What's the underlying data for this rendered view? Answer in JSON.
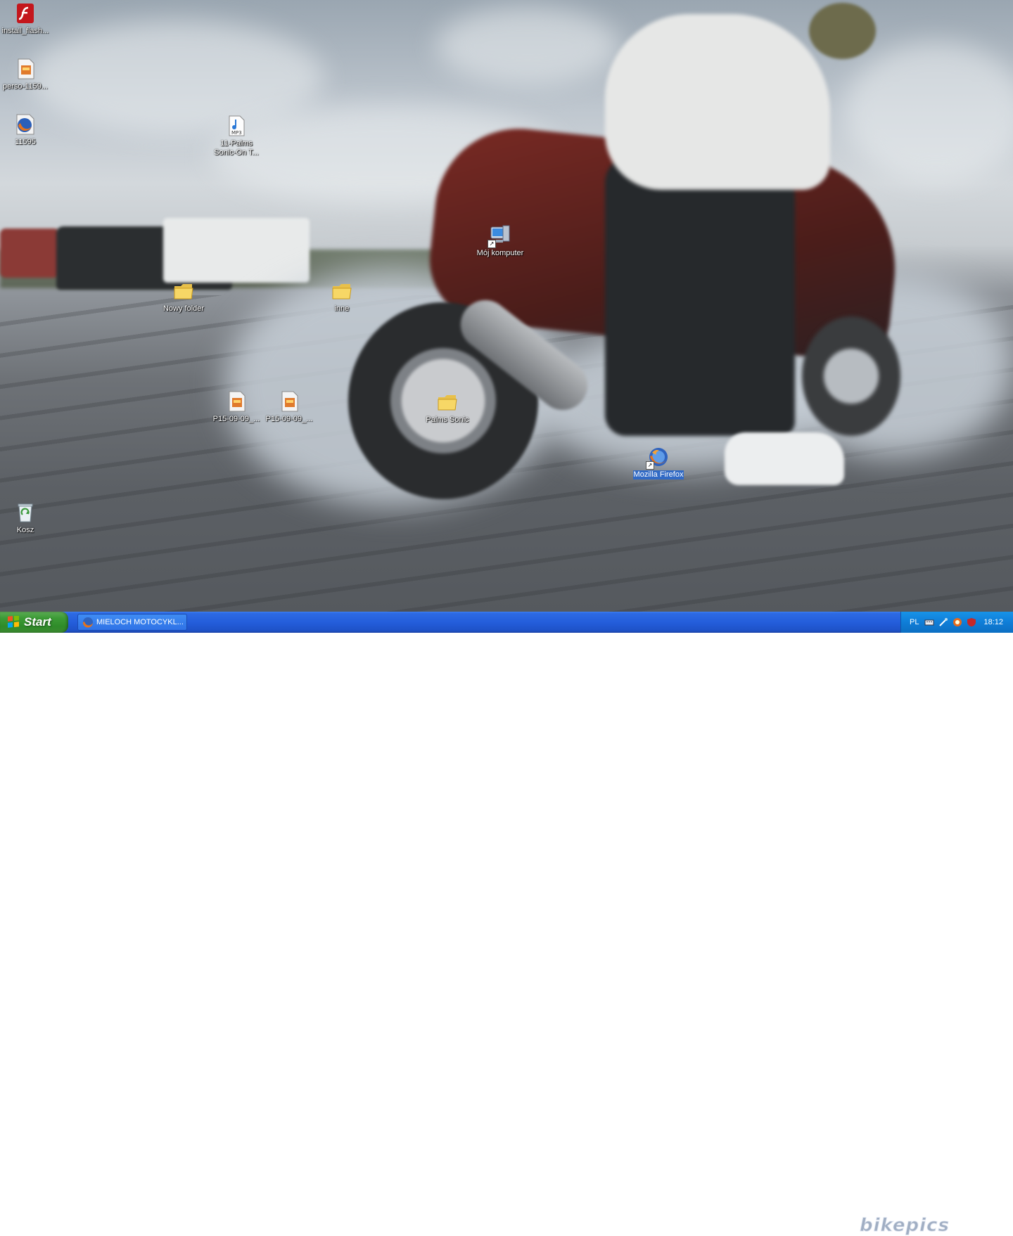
{
  "desktop": {
    "icons": [
      {
        "label": "install_flash...",
        "icon": "flash-installer-icon"
      },
      {
        "label": "perso-1159...",
        "icon": "image-file-icon"
      },
      {
        "label": "11595",
        "icon": "firefox-file-icon"
      },
      {
        "label": "11-Palms Sonic-On T...",
        "icon": "mp3-file-icon"
      },
      {
        "label": "Mój komputer",
        "icon": "my-computer-icon"
      },
      {
        "label": "Nowy folder",
        "icon": "folder-icon"
      },
      {
        "label": "inne",
        "icon": "folder-icon"
      },
      {
        "label": "P15-09-09_...",
        "icon": "image-file-icon"
      },
      {
        "label": "P15-09-09_...",
        "icon": "image-file-icon"
      },
      {
        "label": "Palms Sonic",
        "icon": "folder-icon"
      },
      {
        "label": "Mozilla Firefox",
        "icon": "firefox-icon"
      },
      {
        "label": "Kosz",
        "icon": "recycle-bin-icon"
      }
    ],
    "watermark": "bikepics"
  },
  "taskbar": {
    "start_label": "Start",
    "window_button": "MIELOCH MOTOCYKL...",
    "tray": {
      "language": "PL",
      "clock": "18:12"
    }
  },
  "colors": {
    "taskbar_blue": "#245edb",
    "start_green": "#3c9b36",
    "selection_blue": "#316ac5"
  }
}
